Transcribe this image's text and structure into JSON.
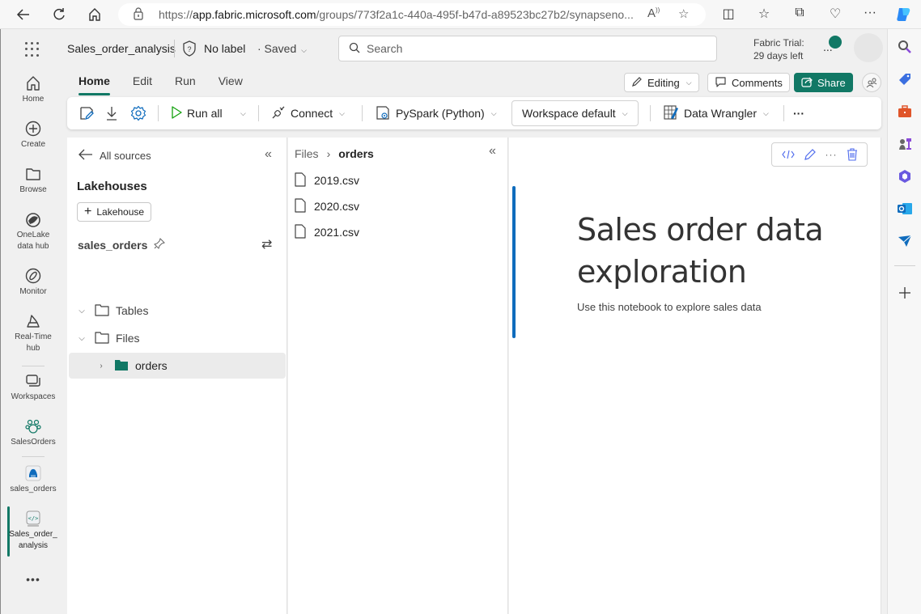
{
  "browser": {
    "url_prefix": "https://",
    "url_host": "app.fabric.microsoft.com",
    "url_rest": "/groups/773f2a1c-440a-495f-b47d-a89523bc27b2/synapseno..."
  },
  "header": {
    "title": "Sales_order_analysis",
    "label": "No label",
    "saved": "· Saved",
    "search_placeholder": "Search",
    "trial_line1": "Fabric Trial:",
    "trial_line2": "29 days left"
  },
  "leftnav": {
    "items": [
      {
        "label": "Home",
        "icon": "home-icon"
      },
      {
        "label": "Create",
        "icon": "plus-circle-icon"
      },
      {
        "label": "Browse",
        "icon": "folder-icon"
      },
      {
        "label": "OneLake data hub",
        "icon": "onelake-icon"
      },
      {
        "label": "Monitor",
        "icon": "monitor-icon"
      },
      {
        "label": "Real-Time hub",
        "icon": "realtime-icon"
      },
      {
        "label": "Workspaces",
        "icon": "workspaces-icon"
      },
      {
        "label": "SalesOrders",
        "icon": "workspace-group-icon"
      },
      {
        "label": "sales_orders",
        "icon": "lakehouse-icon"
      },
      {
        "label": "Sales_order_ analysis",
        "icon": "notebook-icon",
        "active": true
      }
    ],
    "more": "•••"
  },
  "tabs": [
    {
      "label": "Home",
      "active": true
    },
    {
      "label": "Edit"
    },
    {
      "label": "Run"
    },
    {
      "label": "View"
    }
  ],
  "actions": {
    "editing": "Editing",
    "comments": "Comments",
    "share": "Share"
  },
  "toolbar": {
    "run_all": "Run all",
    "connect": "Connect",
    "language": "PySpark (Python)",
    "environment": "Workspace default",
    "data_wrangler": "Data Wrangler",
    "more": "···"
  },
  "lakehouse_panel": {
    "back_label": "All sources",
    "section_title": "Lakehouses",
    "add_button": "Lakehouse",
    "lakehouse_name": "sales_orders",
    "tree": [
      {
        "label": "Tables",
        "expanded": true,
        "level": 0
      },
      {
        "label": "Files",
        "expanded": true,
        "level": 0
      },
      {
        "label": "orders",
        "expanded": false,
        "level": 1,
        "selected": true
      }
    ]
  },
  "files_panel": {
    "breadcrumb": [
      "Files",
      "orders"
    ],
    "files": [
      "2019.csv",
      "2020.csv",
      "2021.csv"
    ]
  },
  "notebook": {
    "heading": "Sales order data exploration",
    "paragraph": "Use this notebook to explore sales data"
  },
  "colors": {
    "brand": "#117865",
    "cell_accent": "#0f6cbd"
  }
}
